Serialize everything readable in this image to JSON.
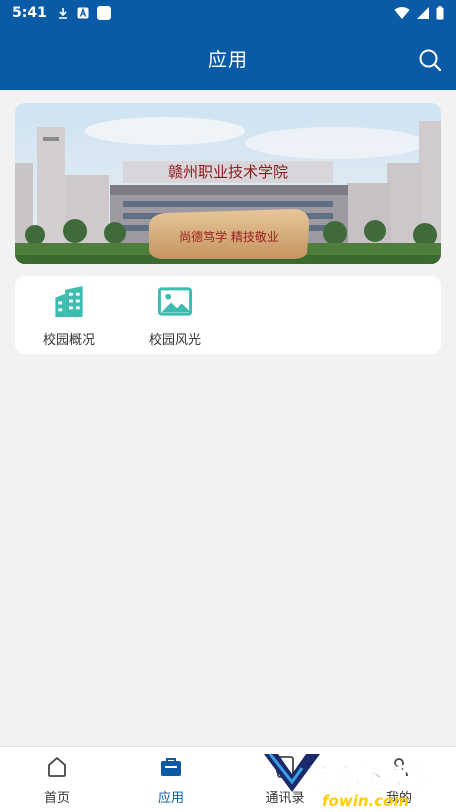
{
  "status_bar": {
    "time": "5:41"
  },
  "header": {
    "title": "应用"
  },
  "banner": {
    "sign_text": "赣州职业技术学院",
    "stone_text": "尚德笃学 精技敬业"
  },
  "apps": [
    {
      "label": "校园概况",
      "icon": "building-icon"
    },
    {
      "label": "校园风光",
      "icon": "image-icon"
    }
  ],
  "tabs": [
    {
      "label": "首页",
      "icon": "home-icon",
      "active": false
    },
    {
      "label": "应用",
      "icon": "briefcase-icon",
      "active": true
    },
    {
      "label": "通讯录",
      "icon": "contacts-icon",
      "active": false
    },
    {
      "label": "我的",
      "icon": "person-icon",
      "active": false
    }
  ],
  "watermark": {
    "text": "清源下载站",
    "url": "fowin.com"
  },
  "colors": {
    "primary": "#0b5aa6",
    "teal": "#3dbdb0",
    "background": "#f2f2f2"
  }
}
